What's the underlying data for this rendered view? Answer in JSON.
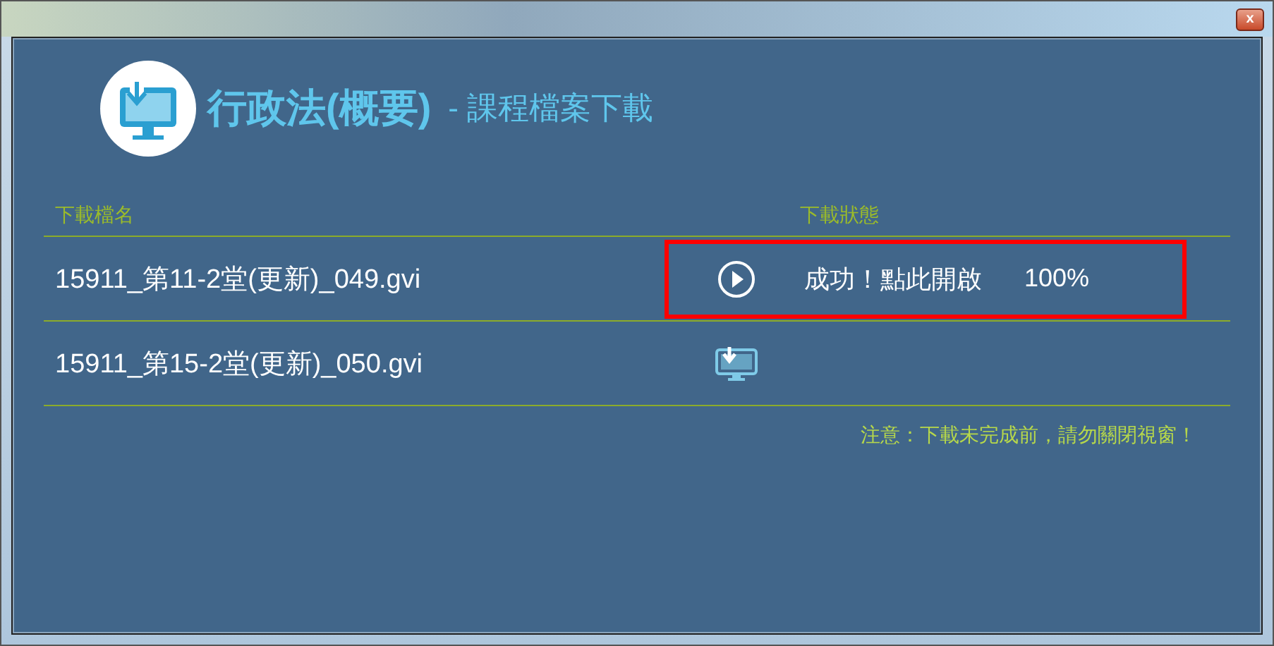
{
  "window": {
    "close_label": "x"
  },
  "header": {
    "title": "行政法(概要)",
    "subtitle": "- 課程檔案下載"
  },
  "table": {
    "columns": [
      "下載檔名",
      "下載狀態"
    ],
    "rows": [
      {
        "file": "15911_第11-2堂(更新)_049.gvi",
        "kind": "done",
        "status": "成功！點此開啟",
        "percent": "100%",
        "highlighted": true
      },
      {
        "file": "15911_第15-2堂(更新)_050.gvi",
        "kind": "pending",
        "highlighted": false
      }
    ]
  },
  "notice": "注意：下載未完成前，請勿關閉視窗！"
}
